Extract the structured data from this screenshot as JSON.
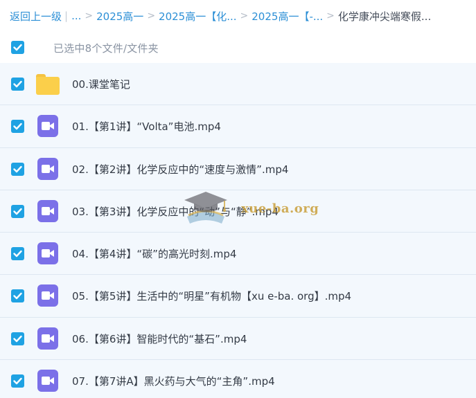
{
  "breadcrumb": {
    "back": "返回上一级",
    "separator": "|",
    "ellipsis": "...",
    "chevron": ">",
    "items": [
      "2025高一",
      "2025高一【化...",
      "2025高一【-...",
      "化学康冲尖端寒假..."
    ]
  },
  "selection": {
    "text": "已选中8个文件/文件夹"
  },
  "files": [
    {
      "icon": "folder-icon",
      "name": "00.课堂笔记"
    },
    {
      "icon": "video-file-icon",
      "name": "01.【第1讲】“Volta”电池.mp4"
    },
    {
      "icon": "video-file-icon",
      "name": "02.【第2讲】化学反应中的“速度与激情”.mp4"
    },
    {
      "icon": "video-file-icon",
      "name": "03.【第3讲】化学反应中的“动”与“静”.mp4"
    },
    {
      "icon": "video-file-icon",
      "name": "04.【第4讲】“碳”的高光时刻.mp4"
    },
    {
      "icon": "video-file-icon",
      "name": "05.【第5讲】生活中的“明星”有机物【xu e-ba. org】.mp4"
    },
    {
      "icon": "video-file-icon",
      "name": "06.【第6讲】智能时代的“基石”.mp4"
    },
    {
      "icon": "video-file-icon",
      "name": "07.【第7讲A】黑火药与大气的“主角”.mp4"
    }
  ],
  "watermark": {
    "text": "xue-ba.org"
  },
  "colors": {
    "accent": "#1fa2e3",
    "link": "#2c8fd6",
    "video_icon": "#7b70e8",
    "folder_icon": "#fbcf4a",
    "row_background": "#f3f8fd"
  }
}
